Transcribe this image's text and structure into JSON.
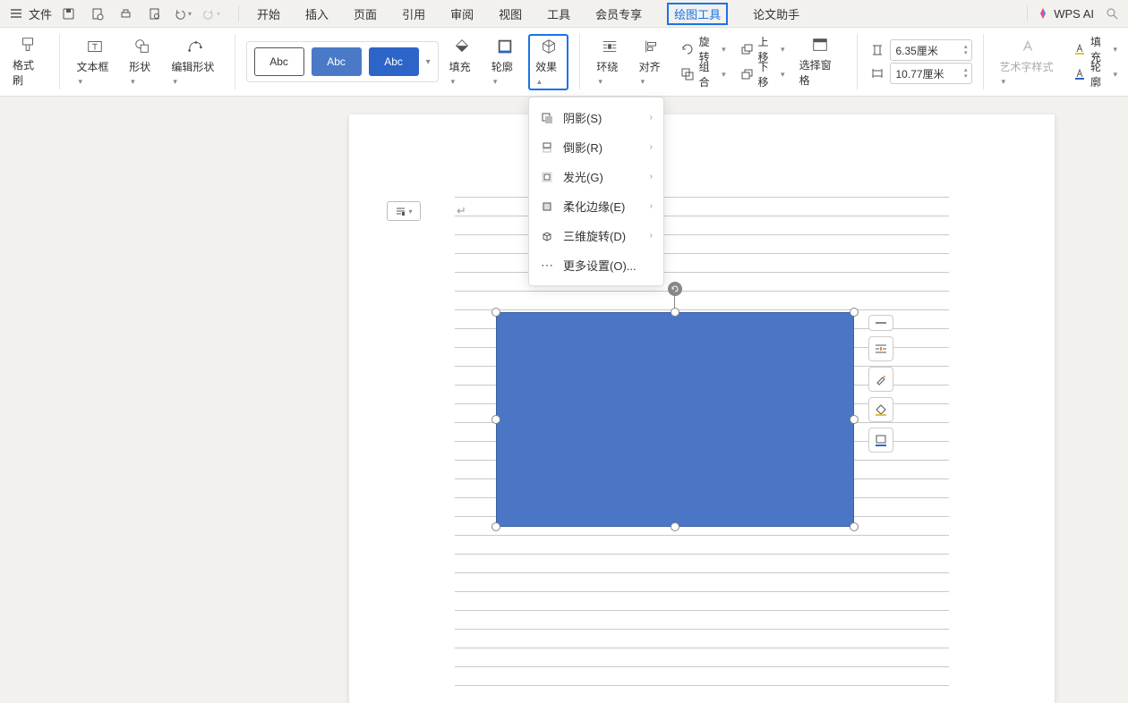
{
  "menubar": {
    "file": "文件",
    "tabs": [
      "开始",
      "插入",
      "页面",
      "引用",
      "审阅",
      "视图",
      "工具",
      "会员专享",
      "绘图工具",
      "论文助手"
    ],
    "active_tab_index": 8,
    "wps_ai": "WPS AI"
  },
  "ribbon": {
    "format_painter": "格式刷",
    "textbox": "文本框",
    "shapes": "形状",
    "edit_shape": "编辑形状",
    "preset_label": "Abc",
    "fill": "填充",
    "outline": "轮廓",
    "effect": "效果",
    "wrap": "环绕",
    "align": "对齐",
    "rotate": "旋转",
    "group": "组合",
    "move_up": "上移",
    "move_down": "下移",
    "selection_pane": "选择窗格",
    "height": "6.35厘米",
    "width": "10.77厘米",
    "art_style": "艺术字样式",
    "text_fill": "填充",
    "text_outline": "轮廓"
  },
  "dropdown": {
    "shadow": "阴影(S)",
    "reflection": "倒影(R)",
    "glow": "发光(G)",
    "soft_edges": "柔化边缘(E)",
    "rotation_3d": "三维旋转(D)",
    "more": "更多设置(O)..."
  },
  "floattools": {
    "collapse": "collapse-icon",
    "layout": "layout-options-icon",
    "format": "format-brush-icon",
    "fill": "fill-bucket-icon",
    "outline": "shape-outline-icon"
  },
  "page": {
    "cursor_mark": "↵"
  }
}
